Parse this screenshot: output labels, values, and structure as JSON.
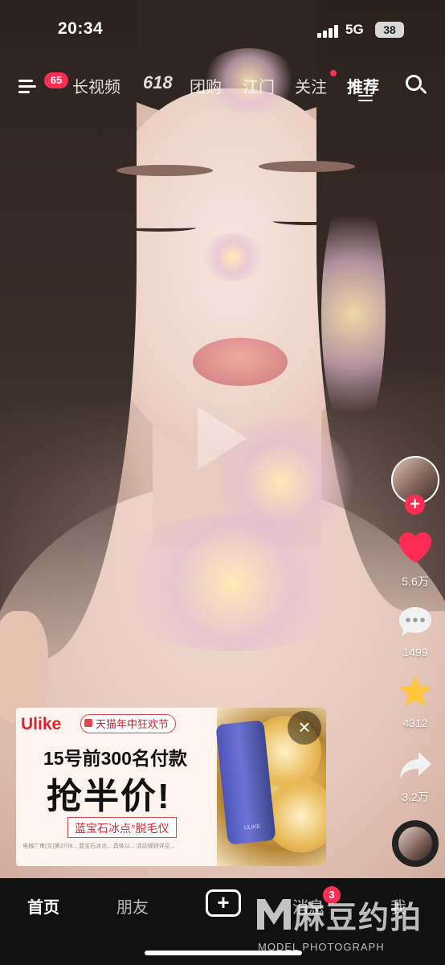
{
  "status_bar": {
    "time": "20:34",
    "network": "5G",
    "battery": "38"
  },
  "top_nav": {
    "menu_badge": "65",
    "tabs": [
      {
        "label": "长视频",
        "active": false
      },
      {
        "label": "618",
        "active": false
      },
      {
        "label": "团购",
        "active": false
      },
      {
        "label": "江门",
        "active": false
      },
      {
        "label": "关注",
        "active": false,
        "dot": true
      },
      {
        "label": "推荐",
        "active": true
      }
    ]
  },
  "actions": {
    "likes": "5.6万",
    "comments": "1499",
    "favorites": "4312",
    "shares": "3.2万"
  },
  "ad": {
    "brand": "Ulike",
    "tmall_tag": "天猫年中狂欢节",
    "line1": "15号前300名付款",
    "line2": "抢半价!",
    "product_tag": "蓝宝石冰点°脱毛仪",
    "fine_print": "电械广审(文)第2708... 蓝宝石冰点... 具体以... 活动规则详见...",
    "device_label": "ULIKE"
  },
  "tab_bar": {
    "home": "首页",
    "friends": "朋友",
    "post": "+",
    "messages": "消息",
    "messages_badge": "3",
    "me": "我"
  },
  "watermark": {
    "cn": "麻豆约拍",
    "en": "MODEL PHOTOGRAPH"
  },
  "colors": {
    "accent": "#ff2d55",
    "like": "#ff2d55",
    "favorite": "#ffc53d",
    "ad_red": "#d7262e"
  }
}
